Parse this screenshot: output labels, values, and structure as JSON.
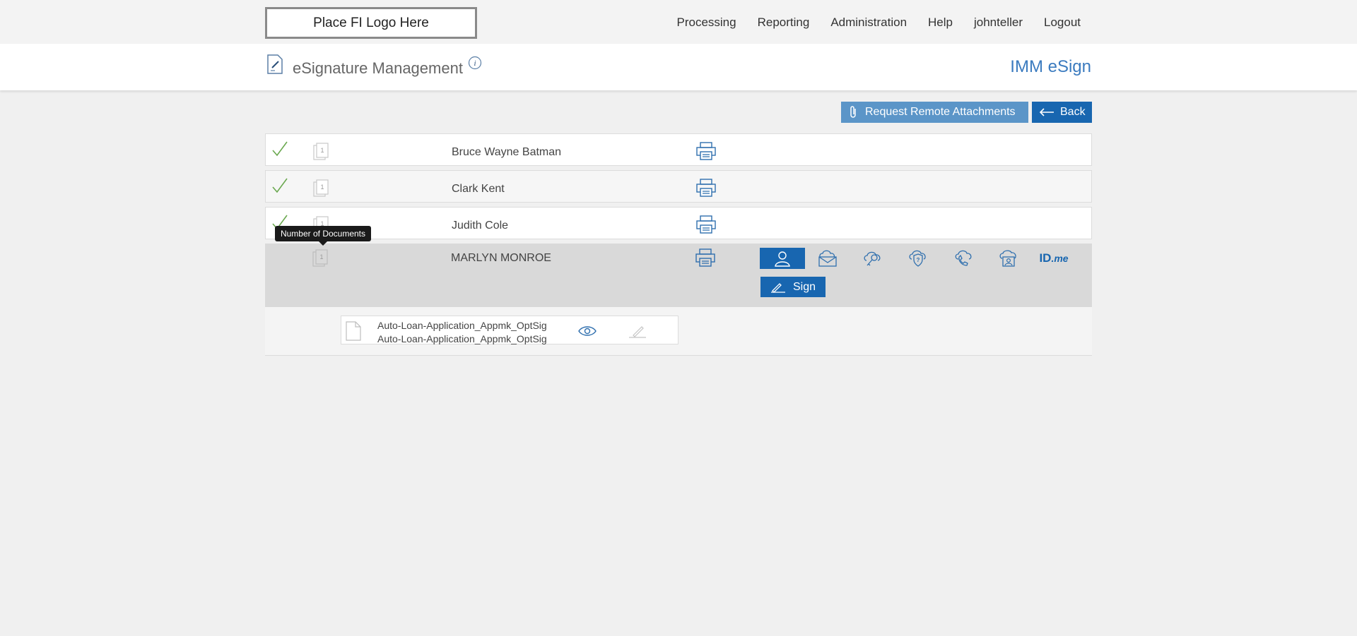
{
  "header": {
    "logo_text": "Place FI Logo Here",
    "nav": [
      "Processing",
      "Reporting",
      "Administration",
      "Help",
      "johnteller",
      "Logout"
    ]
  },
  "titlebar": {
    "title": "eSignature Management",
    "brand": "IMM eSign",
    "icons": [
      "esign-document-icon",
      "info-icon"
    ]
  },
  "actions": {
    "request_attachments": "Request Remote Attachments",
    "back": "Back"
  },
  "signers": [
    {
      "name": "Bruce Wayne Batman",
      "signed": true,
      "doc_count": "1"
    },
    {
      "name": "Clark Kent",
      "signed": true,
      "doc_count": "1"
    },
    {
      "name": "Judith Cole",
      "signed": true,
      "doc_count": "1"
    },
    {
      "name": "MARLYN MONROE",
      "signed": false,
      "doc_count": "1"
    }
  ],
  "active_signer": {
    "auth_methods": [
      "in-person",
      "email",
      "key",
      "security-question",
      "phone",
      "cloud-id",
      "ID.me"
    ],
    "selected_method": "in-person",
    "sign_label": "Sign",
    "idme_label_main": "ID",
    "idme_label_suffix": ".me"
  },
  "documents": [
    {
      "line1": "Auto-Loan-Application_Appmk_OptSig",
      "line2": "Auto-Loan-Application_Appmk_OptSig"
    }
  ],
  "tooltip": "Number of Documents",
  "colors": {
    "accent": "#1866b0",
    "accent_light": "#5b95c8",
    "brand_text": "#3b7bbf",
    "check": "#6aa84f",
    "active_row": "#d9d9d9"
  }
}
